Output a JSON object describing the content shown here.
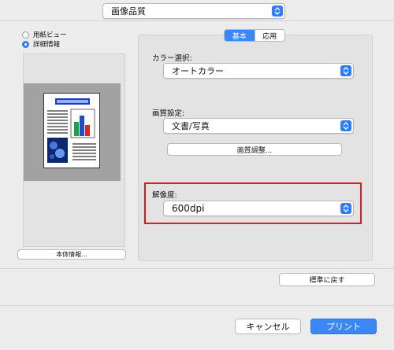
{
  "header": {
    "preset_popup": "画像品質"
  },
  "preview": {
    "radios": [
      {
        "label": "用紙ビュー",
        "selected": false
      },
      {
        "label": "詳細情報",
        "selected": true
      }
    ],
    "info_button": "本体情報..."
  },
  "tabs": [
    {
      "label": "基本",
      "active": true
    },
    {
      "label": "応用",
      "active": false
    }
  ],
  "settings": {
    "color_label": "カラー選択:",
    "color_value": "オートカラー",
    "quality_label": "画質設定:",
    "quality_value": "文書/写真",
    "quality_adjust_button": "画質調整...",
    "resolution_label": "解像度:",
    "resolution_value": "600dpi"
  },
  "restore_button": "標準に戻す",
  "footer": {
    "cancel": "キャンセル",
    "print": "プリント"
  },
  "colors": {
    "accent": "#3b87f7",
    "highlight": "#e0191e"
  }
}
